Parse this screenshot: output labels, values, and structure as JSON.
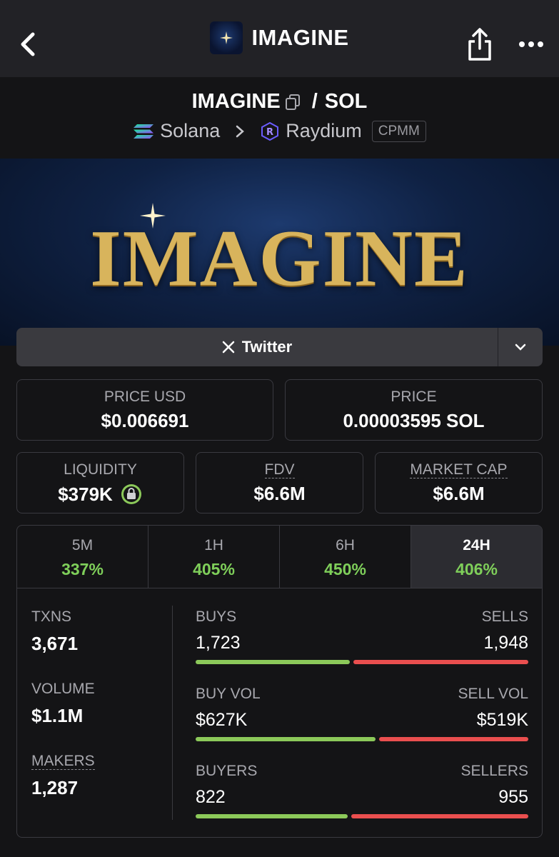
{
  "nav": {
    "title": "IMAGINE"
  },
  "pair": {
    "base": "IMAGINE",
    "separator": "/",
    "quote": "SOL",
    "chain": "Solana",
    "dex": "Raydium",
    "dex_type": "CPMM"
  },
  "banner": {
    "word": "IMAGINE"
  },
  "links": {
    "twitter_label": "Twitter"
  },
  "price": {
    "usd_label": "PRICE USD",
    "usd_value": "$0.006691",
    "native_label": "PRICE",
    "native_value": "0.00003595 SOL"
  },
  "metrics": {
    "liquidity_label": "LIQUIDITY",
    "liquidity_value": "$379K",
    "fdv_label": "FDV",
    "fdv_value": "$6.6M",
    "mcap_label": "MARKET CAP",
    "mcap_value": "$6.6M"
  },
  "timeframes": [
    {
      "label": "5M",
      "change": "337%"
    },
    {
      "label": "1H",
      "change": "405%"
    },
    {
      "label": "6H",
      "change": "450%"
    },
    {
      "label": "24H",
      "change": "406%"
    }
  ],
  "stats": {
    "txns_label": "TXNS",
    "txns_value": "3,671",
    "volume_label": "VOLUME",
    "volume_value": "$1.1M",
    "makers_label": "MAKERS",
    "makers_value": "1,287",
    "buys_label": "BUYS",
    "buys_value": "1,723",
    "sells_label": "SELLS",
    "sells_value": "1,948",
    "buyvol_label": "BUY VOL",
    "buyvol_value": "$627K",
    "sellvol_label": "SELL VOL",
    "sellvol_value": "$519K",
    "buyers_label": "BUYERS",
    "buyers_value": "822",
    "sellers_label": "SELLERS",
    "sellers_value": "955",
    "buys_fraction": 0.469,
    "buyvol_fraction": 0.547,
    "buyers_fraction": 0.463
  },
  "colors": {
    "positive": "#7fcf5a",
    "buy_bar": "#8cc95a",
    "sell_bar": "#ea4f4f"
  }
}
